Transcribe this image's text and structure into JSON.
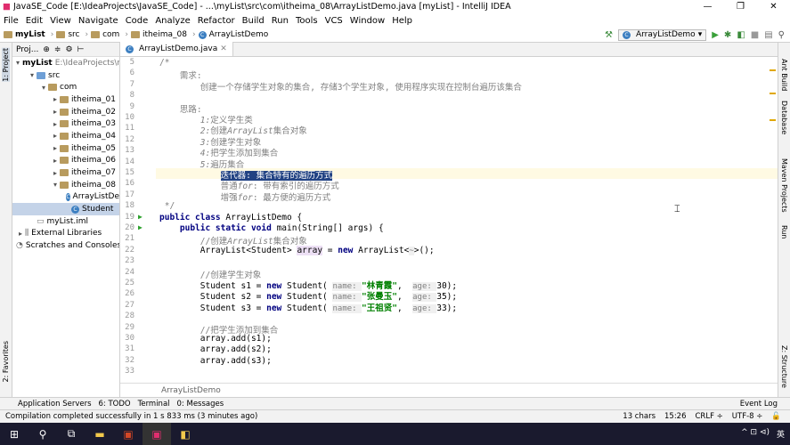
{
  "window": {
    "title": "JavaSE_Code [E:\\IdeaProjects\\JavaSE_Code] - ...\\myList\\src\\com\\itheima_08\\ArrayListDemo.java [myList] - IntelliJ IDEA",
    "min": "—",
    "max": "❐",
    "close": "✕"
  },
  "menu": [
    "File",
    "Edit",
    "View",
    "Navigate",
    "Code",
    "Analyze",
    "Refactor",
    "Build",
    "Run",
    "Tools",
    "VCS",
    "Window",
    "Help"
  ],
  "nav": {
    "crumbs": [
      "myList",
      "src",
      "com",
      "itheima_08",
      "ArrayListDemo"
    ],
    "run_config": "ArrayListDemo"
  },
  "project": {
    "label": "Proj...",
    "tree": [
      {
        "text": "myList",
        "path": "E:\\IdeaProjects\\myList",
        "indent": 0,
        "arrow": "▾",
        "kind": "module"
      },
      {
        "text": "src",
        "indent": 1,
        "arrow": "▾",
        "kind": "folder"
      },
      {
        "text": "com",
        "indent": 2,
        "arrow": "▾",
        "kind": "folder"
      },
      {
        "text": "itheima_01",
        "indent": 3,
        "arrow": "▸",
        "kind": "folder"
      },
      {
        "text": "itheima_02",
        "indent": 3,
        "arrow": "▸",
        "kind": "folder"
      },
      {
        "text": "itheima_03",
        "indent": 3,
        "arrow": "▸",
        "kind": "folder"
      },
      {
        "text": "itheima_04",
        "indent": 3,
        "arrow": "▸",
        "kind": "folder"
      },
      {
        "text": "itheima_05",
        "indent": 3,
        "arrow": "▸",
        "kind": "folder"
      },
      {
        "text": "itheima_06",
        "indent": 3,
        "arrow": "▸",
        "kind": "folder"
      },
      {
        "text": "itheima_07",
        "indent": 3,
        "arrow": "▸",
        "kind": "folder"
      },
      {
        "text": "itheima_08",
        "indent": 3,
        "arrow": "▾",
        "kind": "folder"
      },
      {
        "text": "ArrayListDe",
        "indent": 4,
        "arrow": "",
        "kind": "class"
      },
      {
        "text": "Student",
        "indent": 4,
        "arrow": "",
        "kind": "class",
        "selected": true
      },
      {
        "text": "myList.iml",
        "indent": 1,
        "arrow": "",
        "kind": "file"
      },
      {
        "text": "External Libraries",
        "indent": 0,
        "arrow": "▸",
        "kind": "lib"
      },
      {
        "text": "Scratches and Consoles",
        "indent": 0,
        "arrow": "",
        "kind": "scratch"
      }
    ]
  },
  "editor": {
    "tab": "ArrayListDemo.java",
    "breadcrumb": "ArrayListDemo",
    "lines": [
      {
        "n": "5",
        "html": "<span class='cm'>/*</span>"
      },
      {
        "n": "6",
        "html": "<span class='cm'>    需求:</span>"
      },
      {
        "n": "7",
        "html": "<span class='cm'>        创建一个存储学生对象的集合, 存储3个学生对象, 使用程序实现在控制台遍历该集合</span>"
      },
      {
        "n": "8",
        "html": ""
      },
      {
        "n": "9",
        "html": "<span class='cm'>    思路:</span>"
      },
      {
        "n": "10",
        "html": "<span class='cm'>        </span><span class='cmi'>1:</span><span class='cm'>定义学生类</span>"
      },
      {
        "n": "11",
        "html": "<span class='cm'>        </span><span class='cmi'>2:</span><span class='cm'>创建</span><span class='cmi'>ArrayList</span><span class='cm'>集合对象</span>"
      },
      {
        "n": "12",
        "html": "<span class='cm'>        </span><span class='cmi'>3:</span><span class='cm'>创建学生对象</span>"
      },
      {
        "n": "13",
        "html": "<span class='cm'>        </span><span class='cmi'>4:</span><span class='cm'>把学生添加到集合</span>"
      },
      {
        "n": "14",
        "html": "<span class='cm'>        </span><span class='cmi'>5:</span><span class='cm'>遍历集合</span>"
      },
      {
        "n": "15",
        "html": "<span class='cm'>            </span><span class='selbox'>迭代器: 集合特有的遍历方式</span>",
        "current": true
      },
      {
        "n": "16",
        "html": "<span class='cm'>            普通</span><span class='cmi'>for</span><span class='cm'>: 带有索引的遍历方式</span>"
      },
      {
        "n": "17",
        "html": "<span class='cm'>            增强</span><span class='cmi'>for</span><span class='cm'>: 最方便的遍历方式</span>"
      },
      {
        "n": "18",
        "html": "<span class='cm'> */</span>"
      },
      {
        "n": "19",
        "html": "<span class='kw'>public class</span> ArrayListDemo {",
        "run": true
      },
      {
        "n": "20",
        "html": "    <span class='kw'>public static void</span> main(String[] args) {",
        "run": true
      },
      {
        "n": "21",
        "html": "        <span class='cm'>//创建</span><span class='cmi'>ArrayList</span><span class='cm'>集合对象</span>"
      },
      {
        "n": "22",
        "html": "        ArrayList&lt;Student&gt; <span class='varhl'>array</span> = <span class='kw'>new</span> ArrayList&lt;<span class='hint'>~</span>&gt;();"
      },
      {
        "n": "23",
        "html": ""
      },
      {
        "n": "24",
        "html": "        <span class='cm'>//创建学生对象</span>"
      },
      {
        "n": "25",
        "html": "        Student s1 = <span class='kw'>new</span> Student( <span class='hint'>name: </span><span class='str'>\"林青霞\"</span>,  <span class='hint'>age: </span>30);"
      },
      {
        "n": "26",
        "html": "        Student s2 = <span class='kw'>new</span> Student( <span class='hint'>name: </span><span class='str'>\"张曼玉\"</span>,  <span class='hint'>age: </span>35);"
      },
      {
        "n": "27",
        "html": "        Student s3 = <span class='kw'>new</span> Student( <span class='hint'>name: </span><span class='str'>\"王祖贤\"</span>,  <span class='hint'>age: </span>33);"
      },
      {
        "n": "28",
        "html": ""
      },
      {
        "n": "29",
        "html": "        <span class='cm'>//把学生添加到集合</span>"
      },
      {
        "n": "30",
        "html": "        array.add(s1);"
      },
      {
        "n": "31",
        "html": "        array.add(s2);"
      },
      {
        "n": "32",
        "html": "        array.add(s3);"
      },
      {
        "n": "33",
        "html": ""
      }
    ]
  },
  "left_tools": [
    "1: Project",
    "2: Favorites"
  ],
  "right_tools": [
    "Ant Build",
    "Database",
    "Maven Projects",
    "Run",
    "Z: Structure"
  ],
  "tool_windows": [
    "Application Servers",
    "6: TODO",
    "Terminal",
    "0: Messages"
  ],
  "event_log": "Event Log",
  "status": {
    "message": "Compilation completed successfully in 1 s 833 ms (3 minutes ago)",
    "chars": "13 chars",
    "pos": "15:26",
    "crlf": "CRLF ÷",
    "enc": "UTF-8 ÷"
  },
  "taskbar": {
    "lang": "英",
    "time_area": "^ ⊡ ⊲)"
  }
}
